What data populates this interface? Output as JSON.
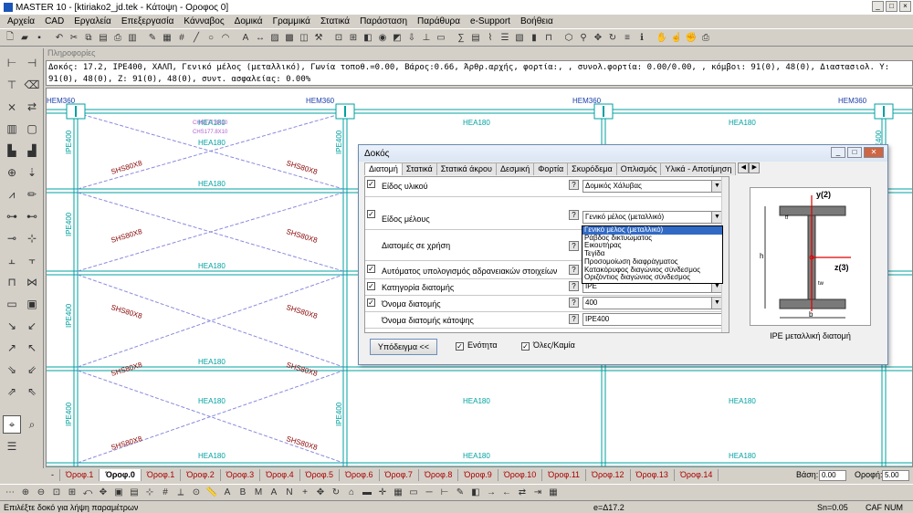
{
  "window": {
    "title": "MASTER 10 - [ktiriako2_jd.tek - Κάτοψη - Οροφος 0]",
    "min": "_",
    "max": "□",
    "close": "×"
  },
  "menu": [
    "Αρχεία",
    "CAD",
    "Εργαλεία",
    "Επεξεργασία",
    "Κάνναβος",
    "Δομικά",
    "Γραμμικά",
    "Στατικά",
    "Παράσταση",
    "Παράθυρα",
    "e-Support",
    "Βοήθεια"
  ],
  "info": {
    "title": "Πληροφορίες",
    "line1": "Δοκός: 17.2, IPE400, ΧΑΛΠ, Γενικό μέλος (μεταλλικό), Γωνία τοποθ.=0.00, Βάρος:0.66, Άρθρ.αρχής, φορτία:, , συνολ.φορτία: 0.00/0.00, , κόμβοι: 91(0), 48(0), Διαστασιολ. Y:",
    "line2": "91(0), 48(0), Z: 91(0), 48(0), συντ. ασφαλείας: 0.00%"
  },
  "canvas": {
    "columns": [
      "HEM360",
      "HEM360",
      "HEM360",
      "HEM360"
    ],
    "beam_h": "HEA180",
    "beam_v": "IPE400",
    "brace": "SHS80X8",
    "chs1": "CHS177.8X10",
    "chs2": "CHS177.8X10"
  },
  "floors": [
    "Όροφ.1",
    "Όροφ.0",
    "Όροφ.1",
    "Όροφ.2",
    "Όροφ.3",
    "Όροφ.4",
    "Όροφ.5",
    "Όροφ.6",
    "Όροφ.7",
    "Όροφ.8",
    "Όροφ.9",
    "Όροφ.10",
    "Όροφ.11",
    "Όροφ.12",
    "Όροφ.13",
    "Όροφ.14"
  ],
  "floor_first": "-",
  "base_label": "Βάση:",
  "base_value": "0.00",
  "roof_label": "Οροφή:",
  "roof_value": "5.00",
  "status": {
    "hint": "Επιλέξτε δοκό για λήψη παραμέτρων",
    "element": "e=Δ17.2",
    "sn": "Sn=0.05",
    "caps": "CAF NUM"
  },
  "dialog": {
    "title": "Δοκός",
    "tabs": [
      "Διατομή",
      "Στατικά",
      "Στατικά άκρου",
      "Δεσμική",
      "Φορτία",
      "Σκυρόδεμα",
      "Οπλισμός",
      "Υλικά - Αποτίμηση"
    ],
    "rows": [
      {
        "label": "Είδος υλικού",
        "value": "Δομικός Χάλυβας",
        "checked": true
      },
      {
        "label": "Είδος μέλους",
        "value": "Γενικό μέλος (μεταλλικό)",
        "checked": true
      },
      {
        "label": "Διατομές σε χρήση",
        "value": "",
        "checked": false
      },
      {
        "label": "Αυτόματος υπολογισμός αδρανειακών στοιχείων",
        "value": "",
        "checked": true
      },
      {
        "label": "Κατηγορία διατομής",
        "value": "IPE",
        "checked": true
      },
      {
        "label": "Όνομα διατομής",
        "value": "400",
        "checked": true
      },
      {
        "label": "Όνομα διατομής κάτοψης",
        "value": "IPE400",
        "checked": false
      }
    ],
    "dropdown": [
      "Γενικό μέλος (μεταλλικό)",
      "Ράβδος δικτυώματος",
      "Εικουτήρας",
      "Τεγίδα",
      "Προσομοίωση διαφράγματος",
      "Κατακόρυφος διαγώνιος σύνδεσμος",
      "Οριζόντιος διαγώνιος σύνδεσμος"
    ],
    "example_btn": "Υπόδειγμα <<",
    "unit_label": "Ενότητα",
    "all_label": "Όλες/Καμία",
    "preview_caption": "IPE μεταλλική διατομή",
    "axis_y": "y(2)",
    "axis_z": "z(3)",
    "dim_h": "h",
    "dim_b": "b",
    "dim_tf": "tf",
    "dim_tw": "tw"
  },
  "colors": {
    "cyan": "#00a0a0",
    "brace": "#8a8ae0",
    "text_red": "#a00000",
    "sel": "#316ac5"
  }
}
